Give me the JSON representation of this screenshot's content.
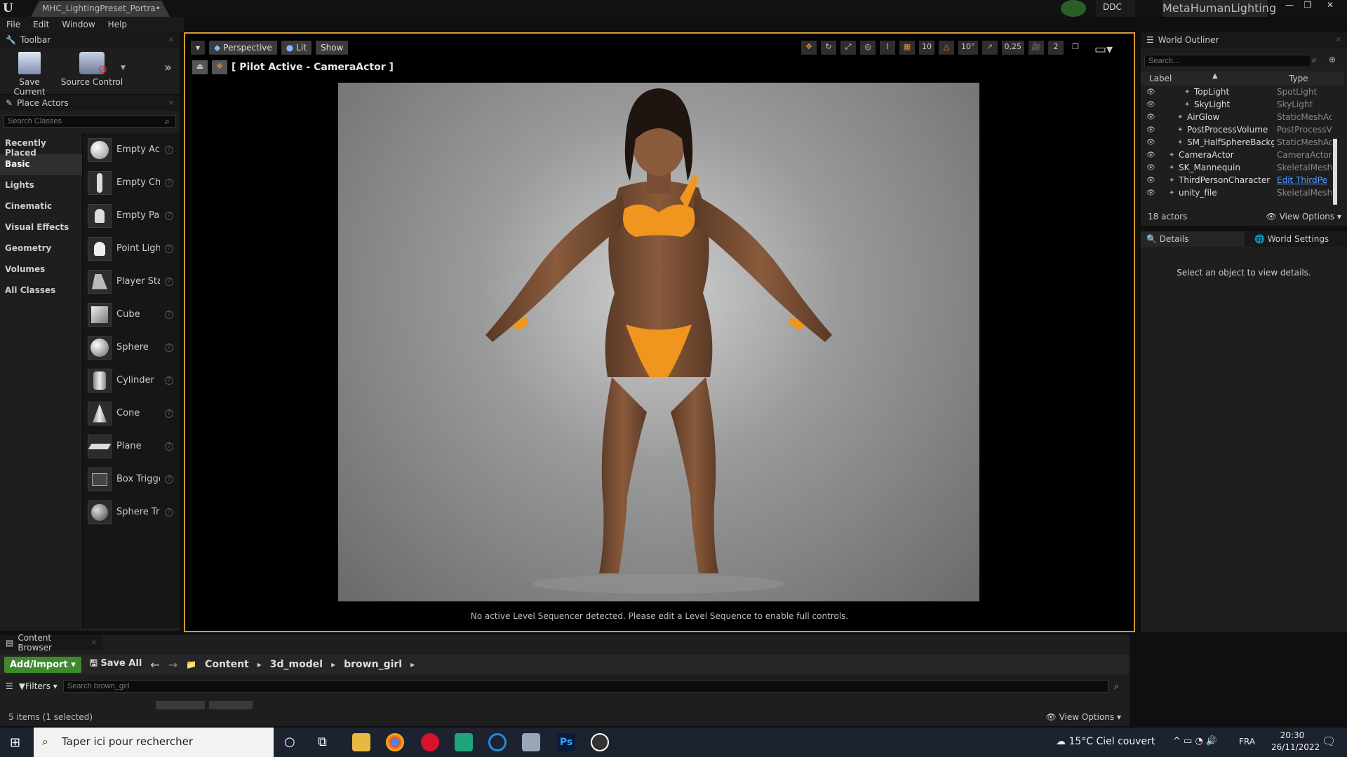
{
  "titlebar": {
    "doc_tab": "MHC_LightingPreset_Portra•",
    "ddc": "DDC",
    "project": "MetaHumanLighting",
    "min": "—",
    "max": "❐",
    "close": "✕"
  },
  "menu": [
    "File",
    "Edit",
    "Window",
    "Help"
  ],
  "toolbar": {
    "title": "Toolbar",
    "save_current": "Save Current",
    "source_control": "Source Control"
  },
  "place_actors": {
    "title": "Place Actors",
    "search_placeholder": "Search Classes",
    "categories": [
      "Recently Placed",
      "Basic",
      "Lights",
      "Cinematic",
      "Visual Effects",
      "Geometry",
      "Volumes",
      "All Classes"
    ],
    "selected_category": "Basic",
    "actors": [
      "Empty Act",
      "Empty Cha",
      "Empty Pav",
      "Point Light",
      "Player Sta",
      "Cube",
      "Sphere",
      "Cylinder",
      "Cone",
      "Plane",
      "Box Trigge",
      "Sphere Tr"
    ]
  },
  "viewport": {
    "perspective": "Perspective",
    "lit": "Lit",
    "show": "Show",
    "grid_snap": "10",
    "rot_snap": "10°",
    "scale_snap": "0,25",
    "cam_speed": "2",
    "pilot": "[ Pilot Active - CameraActor ]",
    "sequencer_msg": "No active Level Sequencer detected. Please edit a Level Sequence to enable full controls."
  },
  "outliner": {
    "title": "World Outliner",
    "search_placeholder": "Search...",
    "col_label": "Label",
    "col_type": "Type",
    "rows": [
      {
        "name": "TopLight",
        "type": "SpotLight",
        "indent": 76
      },
      {
        "name": "SkyLight",
        "type": "SkyLight",
        "indent": 76
      },
      {
        "name": "AirGlow",
        "type": "StaticMeshAc",
        "indent": 66
      },
      {
        "name": "PostProcessVolume",
        "type": "PostProcessV",
        "indent": 66
      },
      {
        "name": "SM_HalfSphereBackg",
        "type": "StaticMeshAc",
        "indent": 66
      },
      {
        "name": "CameraActor",
        "type": "CameraActor",
        "indent": 54
      },
      {
        "name": "SK_Mannequin",
        "type": "SkeletalMesh",
        "indent": 54
      },
      {
        "name": "ThirdPersonCharacter",
        "type": "Edit ThirdPe",
        "indent": 54,
        "link": true
      },
      {
        "name": "unity_file",
        "type": "SkeletalMesh",
        "indent": 54
      }
    ],
    "count": "18 actors",
    "view_options": "View Options"
  },
  "details": {
    "tab_details": "Details",
    "tab_world": "World Settings",
    "empty_msg": "Select an object to view details."
  },
  "content_browser": {
    "title": "Content Browser",
    "add_import": "Add/Import",
    "save_all": "Save All",
    "path": [
      "Content",
      "3d_model",
      "brown_girl"
    ],
    "filters": "Filters",
    "search_placeholder": "Search brown_girl",
    "status": "5 items (1 selected)",
    "view_options": "View Options"
  },
  "taskbar": {
    "search": "Taper ici pour rechercher",
    "weather": "15°C  Ciel couvert",
    "lang": "FRA",
    "time": "20:30",
    "date": "26/11/2022"
  },
  "colors": {
    "accent": "#d39a31",
    "add_import": "#3c8a2c",
    "link": "#4f9dff"
  }
}
